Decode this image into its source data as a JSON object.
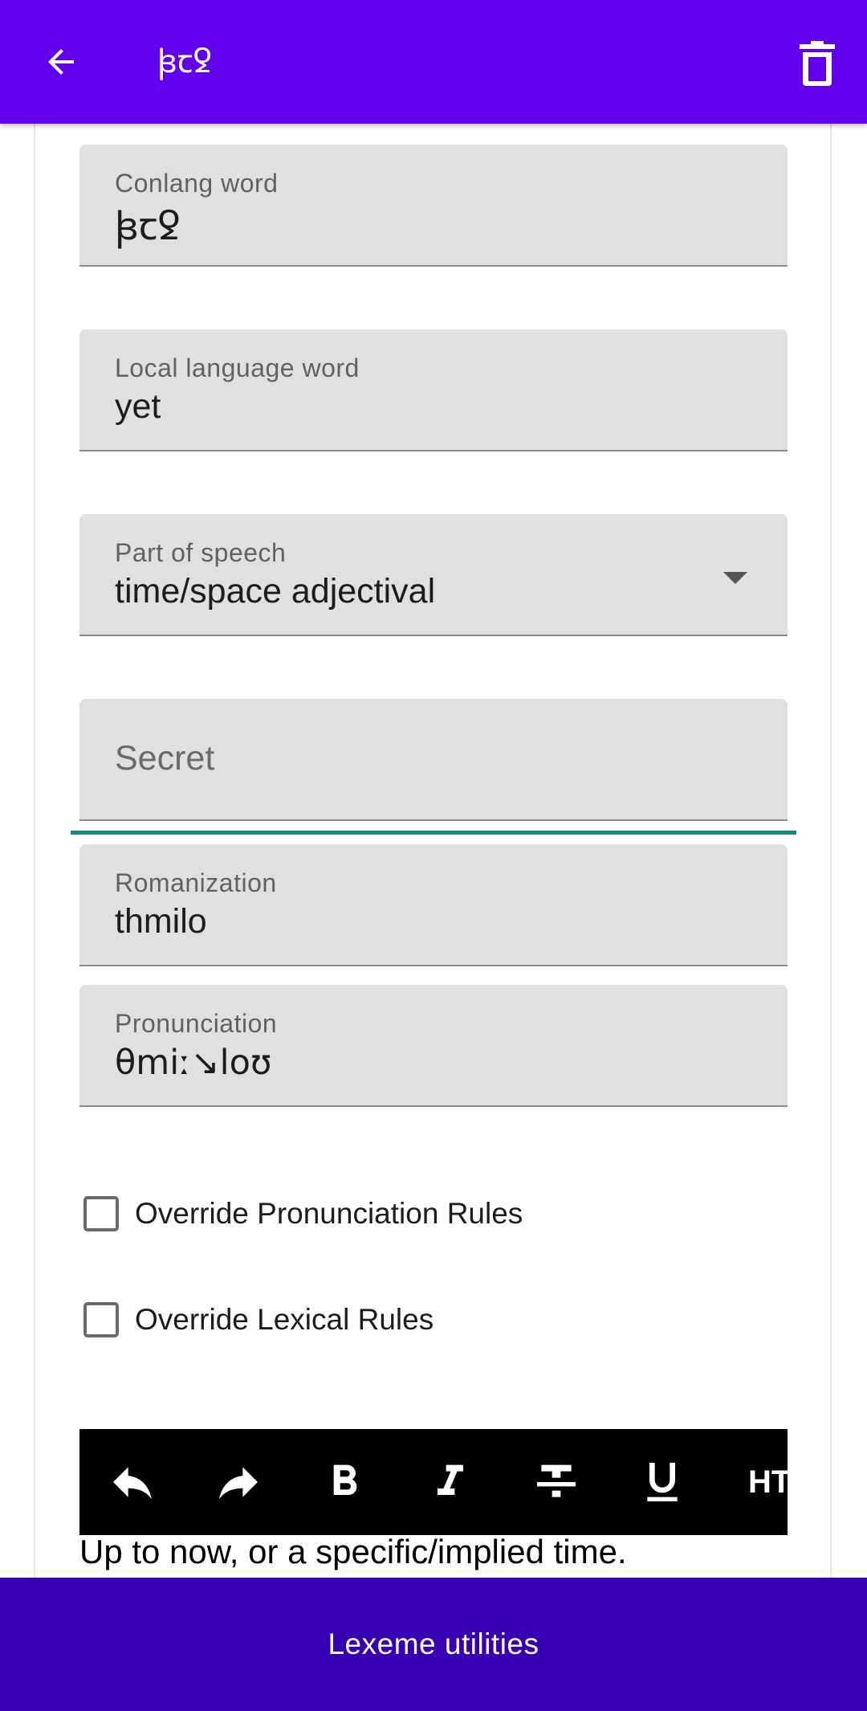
{
  "appbar": {
    "title": "ꟓꞇꝿ",
    "back_icon": "arrow-left-icon",
    "delete_icon": "trash-icon",
    "color": "#6200ee"
  },
  "fields": {
    "conlang_word": {
      "label": "Conlang word",
      "value": "ꟓꞇꝿ"
    },
    "local_word": {
      "label": "Local language word",
      "value": "yet"
    },
    "part_of_speech": {
      "label": "Part of speech",
      "value": "time/space adjectival"
    },
    "secret": {
      "placeholder": "Secret"
    },
    "romanization": {
      "label": "Romanization",
      "value": "thmilo"
    },
    "pronunciation": {
      "label": "Pronunciation",
      "value": "θmiː↘loʊ"
    }
  },
  "checkboxes": {
    "override_pronunciation": {
      "label": "Override Pronunciation Rules",
      "checked": false
    },
    "override_lexical": {
      "label": "Override Lexical Rules",
      "checked": false
    }
  },
  "toolbar": {
    "items": [
      "undo-icon",
      "redo-icon",
      "bold-icon",
      "italic-icon",
      "strikethrough-icon",
      "underline-icon"
    ],
    "html_label": "HTML"
  },
  "editor": {
    "text": "Up to now, or a specific/implied time."
  },
  "bottom_bar": {
    "label": "Lexeme utilities",
    "color": "#3700b3"
  },
  "colors": {
    "focus_accent": "#148a87",
    "field_bg": "#e0e0e0"
  }
}
